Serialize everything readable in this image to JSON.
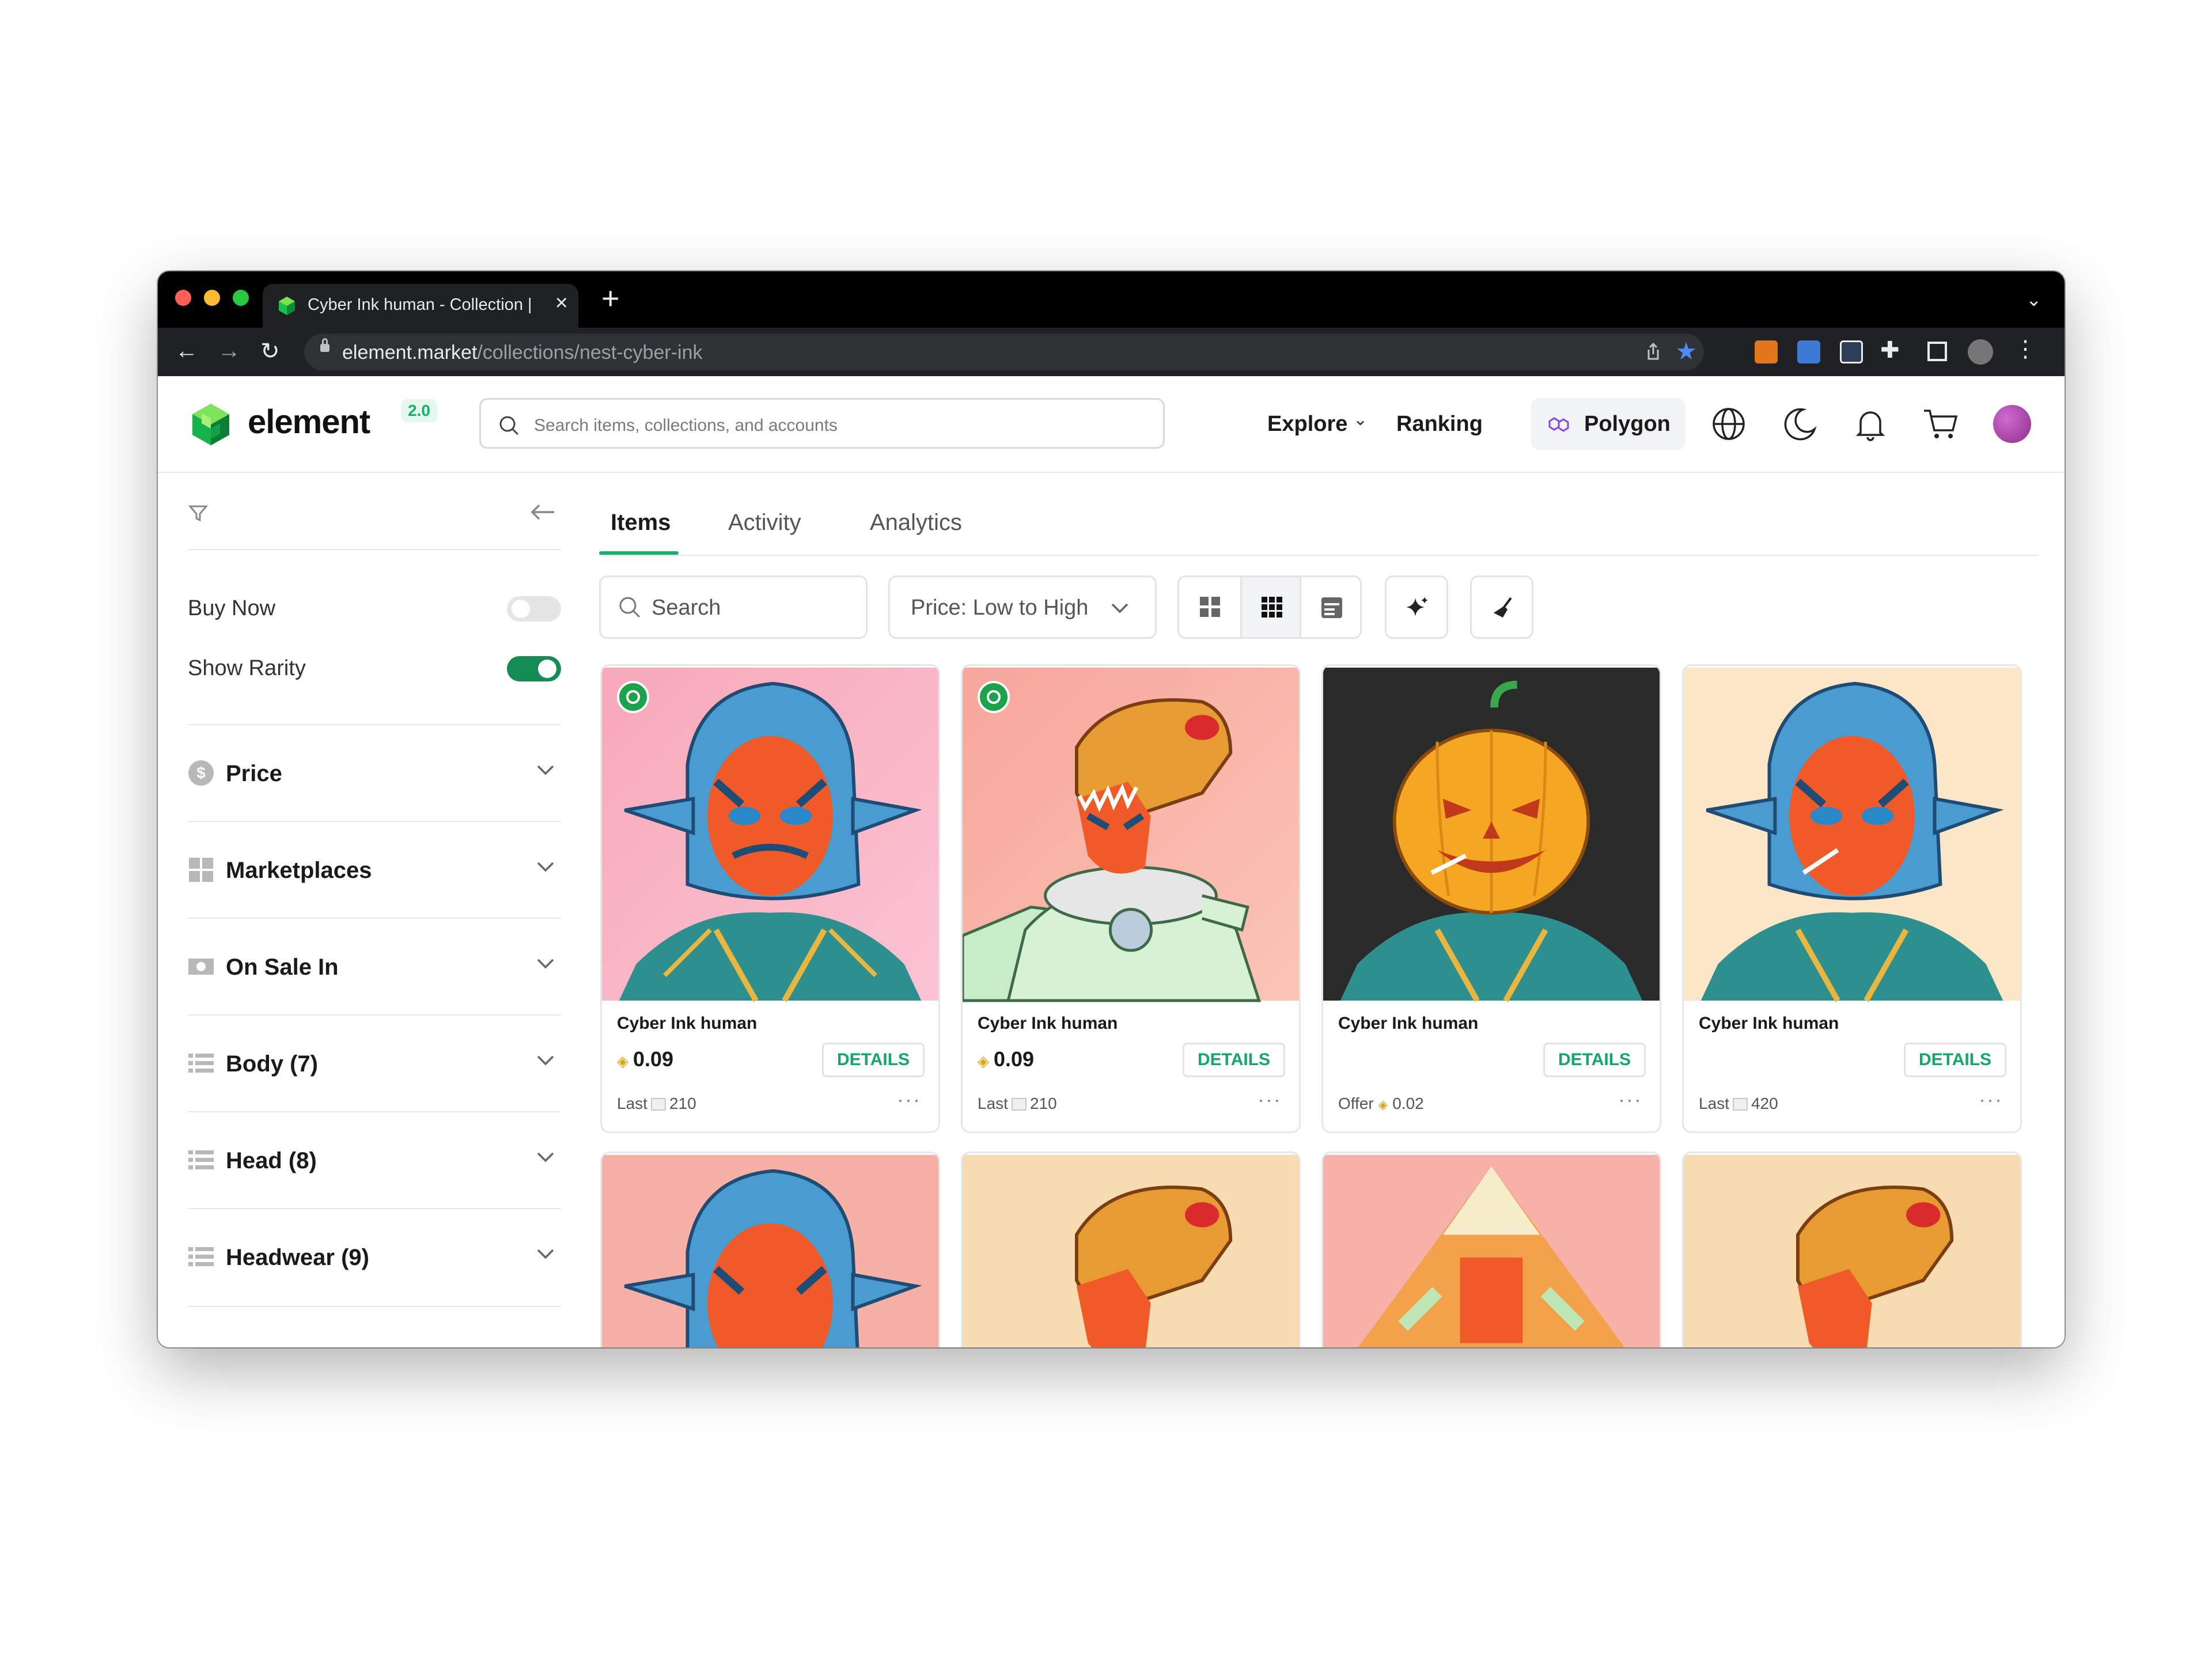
{
  "browser": {
    "tab_title": "Cyber Ink human - Collection |",
    "url_host": "element.market",
    "url_path": "/collections/nest-cyber-ink"
  },
  "header": {
    "logo_text": "element",
    "logo_version": "2.0",
    "search_placeholder": "Search items, collections, and accounts",
    "nav": {
      "explore": "Explore",
      "ranking": "Ranking"
    },
    "chain": "Polygon"
  },
  "sidebar": {
    "toggles": [
      {
        "label": "Buy Now",
        "on": false
      },
      {
        "label": "Show Rarity",
        "on": true
      }
    ],
    "filters": [
      {
        "label": "Price",
        "icon": "dollar-icon"
      },
      {
        "label": "Marketplaces",
        "icon": "grid-icon"
      },
      {
        "label": "On Sale In",
        "icon": "money-icon"
      },
      {
        "label": "Body (7)",
        "icon": "list-icon"
      },
      {
        "label": "Head (8)",
        "icon": "list-icon"
      },
      {
        "label": "Headwear (9)",
        "icon": "list-icon"
      }
    ]
  },
  "main": {
    "tabs": [
      "Items",
      "Activity",
      "Analytics"
    ],
    "active_tab": "Items",
    "search_placeholder": "Search",
    "sort": "Price: Low to High",
    "cards": [
      {
        "name": "Cyber Ink human",
        "price": "0.09",
        "details": "DETAILS",
        "footer_label": "Last",
        "footer_value": "210"
      },
      {
        "name": "Cyber Ink human",
        "price": "0.09",
        "details": "DETAILS",
        "footer_label": "Last",
        "footer_value": "210"
      },
      {
        "name": "Cyber Ink human",
        "price": "",
        "details": "DETAILS",
        "footer_label": "Offer",
        "footer_value": "0.02"
      },
      {
        "name": "Cyber Ink human",
        "price": "",
        "details": "DETAILS",
        "footer_label": "Last",
        "footer_value": "420"
      }
    ]
  },
  "colors": {
    "accent": "#17b06b",
    "eth": "#e3a414"
  }
}
